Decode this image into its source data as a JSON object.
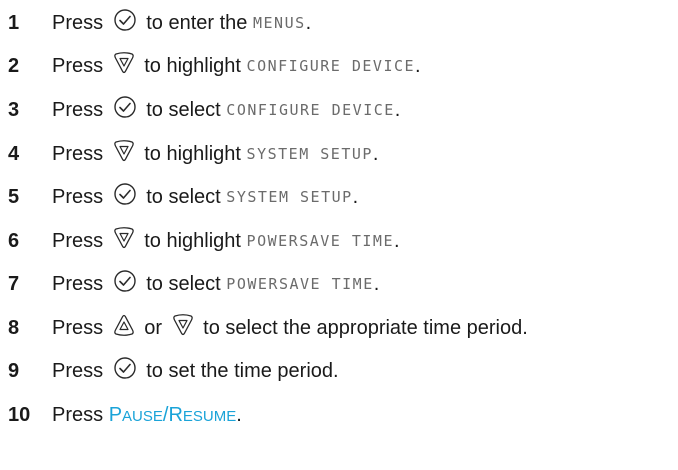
{
  "steps": [
    {
      "num": "1",
      "parts": [
        {
          "t": "text",
          "v": "Press "
        },
        {
          "t": "icon",
          "v": "select-icon"
        },
        {
          "t": "text",
          "v": " to enter the "
        },
        {
          "t": "lcd",
          "v": "MENUS"
        },
        {
          "t": "text",
          "v": "."
        }
      ]
    },
    {
      "num": "2",
      "parts": [
        {
          "t": "text",
          "v": "Press "
        },
        {
          "t": "icon",
          "v": "down-arrow-icon"
        },
        {
          "t": "text",
          "v": " to highlight "
        },
        {
          "t": "lcd",
          "v": "CONFIGURE DEVICE"
        },
        {
          "t": "text",
          "v": "."
        }
      ]
    },
    {
      "num": "3",
      "parts": [
        {
          "t": "text",
          "v": "Press "
        },
        {
          "t": "icon",
          "v": "select-icon"
        },
        {
          "t": "text",
          "v": " to select "
        },
        {
          "t": "lcd",
          "v": "CONFIGURE DEVICE"
        },
        {
          "t": "text",
          "v": "."
        }
      ]
    },
    {
      "num": "4",
      "parts": [
        {
          "t": "text",
          "v": "Press "
        },
        {
          "t": "icon",
          "v": "down-arrow-icon"
        },
        {
          "t": "text",
          "v": " to highlight "
        },
        {
          "t": "lcd",
          "v": "SYSTEM SETUP"
        },
        {
          "t": "text",
          "v": "."
        }
      ]
    },
    {
      "num": "5",
      "parts": [
        {
          "t": "text",
          "v": "Press "
        },
        {
          "t": "icon",
          "v": "select-icon"
        },
        {
          "t": "text",
          "v": " to select "
        },
        {
          "t": "lcd",
          "v": "SYSTEM SETUP"
        },
        {
          "t": "text",
          "v": "."
        }
      ]
    },
    {
      "num": "6",
      "parts": [
        {
          "t": "text",
          "v": "Press "
        },
        {
          "t": "icon",
          "v": "down-arrow-icon"
        },
        {
          "t": "text",
          "v": " to highlight "
        },
        {
          "t": "lcd",
          "v": "POWERSAVE TIME"
        },
        {
          "t": "text",
          "v": "."
        }
      ]
    },
    {
      "num": "7",
      "parts": [
        {
          "t": "text",
          "v": "Press "
        },
        {
          "t": "icon",
          "v": "select-icon"
        },
        {
          "t": "text",
          "v": " to select "
        },
        {
          "t": "lcd",
          "v": "POWERSAVE TIME"
        },
        {
          "t": "text",
          "v": "."
        }
      ]
    },
    {
      "num": "8",
      "parts": [
        {
          "t": "text",
          "v": "Press "
        },
        {
          "t": "icon",
          "v": "up-arrow-icon"
        },
        {
          "t": "text",
          "v": " or "
        },
        {
          "t": "icon",
          "v": "down-arrow-icon"
        },
        {
          "t": "text",
          "v": " to select the appropriate time period."
        }
      ]
    },
    {
      "num": "9",
      "parts": [
        {
          "t": "text",
          "v": "Press "
        },
        {
          "t": "icon",
          "v": "select-icon"
        },
        {
          "t": "text",
          "v": " to set the time period."
        }
      ]
    },
    {
      "num": "10",
      "parts": [
        {
          "t": "text",
          "v": "Press "
        },
        {
          "t": "key",
          "v": "PAUSE/RESUME"
        },
        {
          "t": "text",
          "v": "."
        }
      ]
    }
  ],
  "colors": {
    "text": "#1a1a1a",
    "lcd": "#6b6b6b",
    "key": "#1aa3d8"
  }
}
